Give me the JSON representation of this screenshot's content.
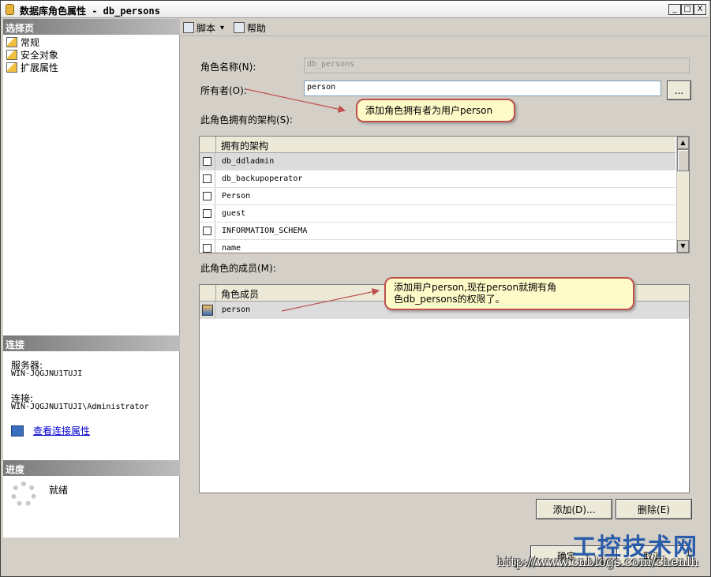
{
  "window": {
    "title": "数据库角色属性 - db_persons",
    "buttons": {
      "minimize": "_",
      "maximize": "□",
      "close": "X"
    }
  },
  "left": {
    "select_page_header": "选择页",
    "nav_items": [
      {
        "label": "常规",
        "icon": "page-icon"
      },
      {
        "label": "安全对象",
        "icon": "page-icon"
      },
      {
        "label": "扩展属性",
        "icon": "page-icon"
      }
    ],
    "connection_header": "连接",
    "server_label": "服务器:",
    "server_value": "WIN-JQGJNU1TUJI",
    "connection_label": "连接:",
    "connection_value": "WIN-JQGJNU1TUJI\\Administrator",
    "view_conn_link": "查看连接属性",
    "progress_header": "进度",
    "status": "就绪"
  },
  "toolbar": {
    "script_label": "脚本",
    "script_dropdown": "▾",
    "help_label": "帮助"
  },
  "form": {
    "role_name_label": "角色名称(N):",
    "role_name_value": "db_persons",
    "owner_label": "所有者(O):",
    "owner_value": "person",
    "browse_button": "...",
    "owned_schemas_label": "此角色拥有的架构(S):",
    "schemas_header": "拥有的架构",
    "schemas": [
      {
        "name": "db_ddladmin",
        "checked": false
      },
      {
        "name": "db_backupoperator",
        "checked": false
      },
      {
        "name": "Person",
        "checked": false
      },
      {
        "name": "guest",
        "checked": false
      },
      {
        "name": "INFORMATION_SCHEMA",
        "checked": false
      },
      {
        "name": "name",
        "checked": false
      }
    ],
    "members_label": "此角色的成员(M):",
    "members_header": "角色成员",
    "members": [
      {
        "name": "person"
      }
    ],
    "add_button": "添加(D)...",
    "remove_button": "删除(E)",
    "ok_button": "确定",
    "cancel_button": "取消"
  },
  "callouts": {
    "owner_note": "添加角色拥有者为用户person",
    "member_note_line1": "添加用户person,现在person就拥有角",
    "member_note_line2": "色db_persons的权限了。"
  },
  "watermark": {
    "logo": "工控技术网",
    "url": "http://www.cnblogs.com/chenlh"
  },
  "colors": {
    "callout_border": "#c0504d",
    "callout_fill": "#fffbc8",
    "link": "#0000cc",
    "watermark_blue": "#2a5caa"
  }
}
